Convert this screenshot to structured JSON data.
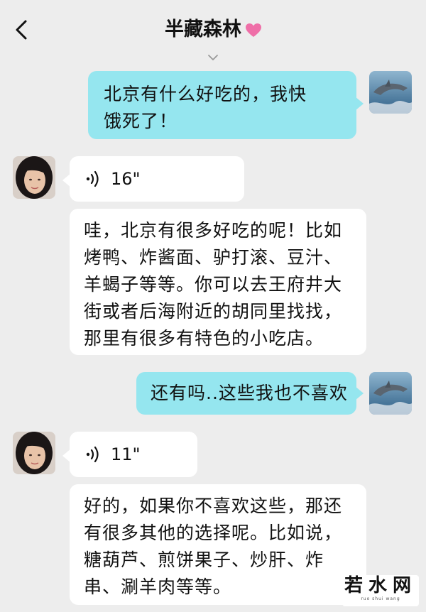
{
  "header": {
    "title": "半藏森林",
    "back_icon": "chevron-left-icon",
    "heart_color": "#ef6fa8"
  },
  "colors": {
    "outgoing_bubble": "#95e6ef",
    "incoming_bubble": "#ffffff",
    "background": "#ededed"
  },
  "messages": [
    {
      "from": "me",
      "type": "text",
      "lines": [
        "北京有什么好吃的，我快",
        "饿死了！"
      ]
    },
    {
      "from": "contact",
      "type": "voice",
      "duration": "16\""
    },
    {
      "from": "contact",
      "type": "text",
      "lines": [
        "哇，北京有很多好吃的呢！比如",
        "烤鸭、炸酱面、驴打滚、豆汁、",
        "羊蝎子等等。你可以去王府井大",
        "街或者后海附近的胡同里找找，",
        "那里有很多有特色的小吃店。"
      ]
    },
    {
      "from": "me",
      "type": "text",
      "lines": [
        "还有吗..这些我也不喜欢"
      ]
    },
    {
      "from": "contact",
      "type": "voice",
      "duration": "11\""
    },
    {
      "from": "contact",
      "type": "text",
      "lines": [
        "好的，如果你不喜欢这些，那还",
        "有很多其他的选择呢。比如说，",
        "糖葫芦、煎饼果子、炒肝、炸",
        "串、涮羊肉等等。"
      ]
    }
  ],
  "watermark": {
    "main": "若水网",
    "sub": "ruo shui wang"
  }
}
